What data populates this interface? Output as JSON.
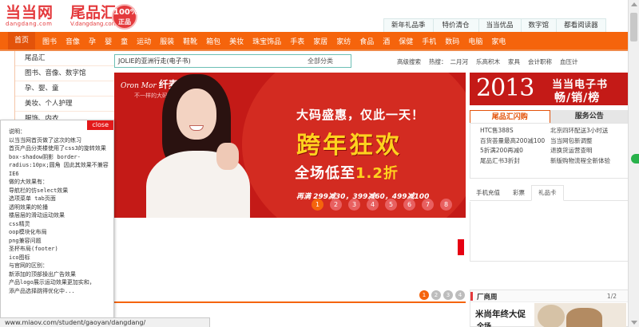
{
  "brand": {
    "logo_main": "当当网",
    "logo_sub": "dangdang.com",
    "site_name": "尾品汇",
    "site_sub": "V.dangdang.com",
    "seal_pct": "100%",
    "seal_word": "正品"
  },
  "top_tabs": [
    "新年礼品季",
    "特价清仓",
    "当当优品",
    "数字馆",
    "都看阅读器"
  ],
  "nav": [
    "首页",
    "图书",
    "音像",
    "孕",
    "婴",
    "童",
    "运动",
    "服装",
    "鞋靴",
    "箱包",
    "美妆",
    "珠宝饰品",
    "手表",
    "家居",
    "家纺",
    "食品",
    "酒",
    "保健",
    "手机",
    "数码",
    "电脑",
    "家电"
  ],
  "left_categories": [
    "尾品汇",
    "图书、音像、数字馆",
    "孕、婴、童",
    "美妆、个人护理",
    "服饰、内衣"
  ],
  "search": {
    "value": "JOLIE的亚洲行走(电子书)",
    "scope": "全部分类"
  },
  "hot": {
    "advanced": "高级搜索",
    "label": "热搜：",
    "items": [
      "二月河",
      "乐高积木",
      "家具",
      "会计职称",
      "血压计"
    ]
  },
  "banner": {
    "brand_latin": "Oron Mor",
    "brand_cn": "纤麦",
    "tagline": "不一样的大码",
    "line1": "大码盛惠，仅此一天！",
    "line2": "跨年狂欢",
    "line3_a": "全场低至",
    "line3_b": "1.2折",
    "line4": "再满 299减30，399减60，499减100",
    "pages": [
      "1",
      "2",
      "3",
      "4",
      "5",
      "6",
      "7",
      "8"
    ],
    "active_page": "1"
  },
  "ebook": {
    "year": "2013",
    "title1": "当当电子书",
    "title2": "畅/销/榜"
  },
  "flash": {
    "tab_active": "尾品汇闪购",
    "tab_other": "服务公告",
    "left": [
      "HTC售388S",
      "百货荟量最高200减100",
      "5折满200再减0",
      "尾品汇书3折封"
    ],
    "right": [
      "北京四环配送3小时送",
      "当当网包新调整",
      "退换货运营查明",
      "新版购物流程全新体验"
    ]
  },
  "subtabs": [
    "手机充值",
    "彩票",
    "礼品卡"
  ],
  "subtab_active": "礼品卡",
  "pager": [
    "1",
    "2",
    "3",
    "4"
  ],
  "pager_active": "1",
  "fav": {
    "title": "厂商周",
    "page": "1/2",
    "text1": "米尚年终大促",
    "text2": "全场"
  },
  "notes": {
    "close": "close",
    "lines": [
      "说明：",
      "以当当网首页做了这次的练习",
      "首页产品分类楼使用了css3的旋转效果",
      "box-shadow阴影 border-",
      "radius:10px;圆角 因此其效果不兼容",
      "IE6",
      "做的大效果有：",
      "导航栏的仿select效果",
      "选项菜单 tab页面",
      "透明效果的轮播",
      "楼层层的滑动运动效果",
      "css精灵",
      "oop模块化布局",
      "png兼容问题",
      "圣杯布局(footer)",
      "ico图标",
      "与官网的区别：",
      "新添加的顶部操出广告效果",
      "产品logo展示运动效果更加实和，",
      "添产品选择跳得优化中..."
    ]
  },
  "status_url": "www.miaov.com/student/gaoyan/dangdang/",
  "colors": {
    "nav": "#f5640c",
    "brand_red": "#e4393c",
    "banner": "#c41a17",
    "banner_accent": "#ffd21f"
  }
}
